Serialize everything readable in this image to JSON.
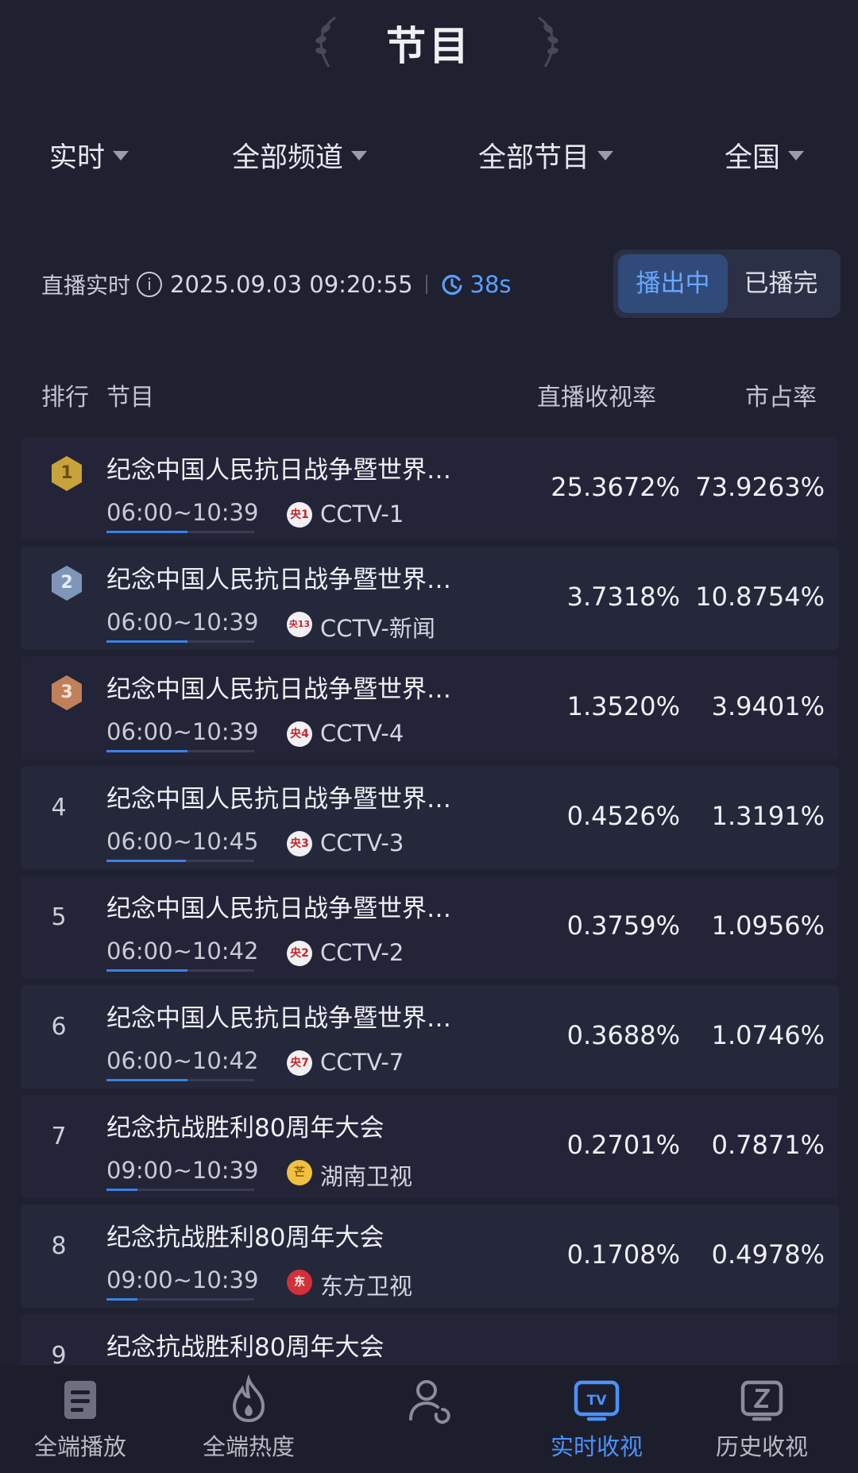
{
  "header": {
    "title": "节目"
  },
  "filters": [
    {
      "label": "实时"
    },
    {
      "label": "全部频道"
    },
    {
      "label": "全部节目"
    },
    {
      "label": "全国"
    }
  ],
  "live": {
    "label": "直播实时",
    "timestamp": "2025.09.03 09:20:55",
    "refresh": "38s"
  },
  "toggle": {
    "on": "播出中",
    "off": "已播完"
  },
  "table": {
    "headers": {
      "rank": "排行",
      "program": "节目",
      "rating": "直播收视率",
      "share": "市占率"
    },
    "rows": [
      {
        "rank": "1",
        "title": "纪念中国人民抗日战争暨世界…",
        "time": "06:00~10:39",
        "channel": "CCTV-1",
        "logo": "央1",
        "rating": "25.3672%",
        "share": "73.9263%",
        "progress": 0.55
      },
      {
        "rank": "2",
        "title": "纪念中国人民抗日战争暨世界…",
        "time": "06:00~10:39",
        "channel": "CCTV-新闻",
        "logo": "央13",
        "rating": "3.7318%",
        "share": "10.8754%",
        "progress": 0.55
      },
      {
        "rank": "3",
        "title": "纪念中国人民抗日战争暨世界…",
        "time": "06:00~10:39",
        "channel": "CCTV-4",
        "logo": "央4",
        "rating": "1.3520%",
        "share": "3.9401%",
        "progress": 0.55
      },
      {
        "rank": "4",
        "title": "纪念中国人民抗日战争暨世界…",
        "time": "06:00~10:45",
        "channel": "CCTV-3",
        "logo": "央3",
        "rating": "0.4526%",
        "share": "1.3191%",
        "progress": 0.54
      },
      {
        "rank": "5",
        "title": "纪念中国人民抗日战争暨世界…",
        "time": "06:00~10:42",
        "channel": "CCTV-2",
        "logo": "央2",
        "rating": "0.3759%",
        "share": "1.0956%",
        "progress": 0.55
      },
      {
        "rank": "6",
        "title": "纪念中国人民抗日战争暨世界…",
        "time": "06:00~10:42",
        "channel": "CCTV-7",
        "logo": "央7",
        "rating": "0.3688%",
        "share": "1.0746%",
        "progress": 0.55
      },
      {
        "rank": "7",
        "title": "纪念抗战胜利80周年大会",
        "time": "09:00~10:39",
        "channel": "湖南卫视",
        "logo": "芒",
        "rating": "0.2701%",
        "share": "0.7871%",
        "progress": 0.21
      },
      {
        "rank": "8",
        "title": "纪念抗战胜利80周年大会",
        "time": "09:00~10:39",
        "channel": "东方卫视",
        "logo": "东",
        "rating": "0.1708%",
        "share": "0.4978%",
        "progress": 0.21
      },
      {
        "rank": "9",
        "title": "纪念抗战胜利80周年大会",
        "time": "",
        "channel": "",
        "logo": "",
        "rating": "",
        "share": "",
        "progress": 0
      }
    ]
  },
  "nav": [
    {
      "label": "全端播放",
      "icon": "document-icon"
    },
    {
      "label": "全端热度",
      "icon": "flame-icon"
    },
    {
      "label": "",
      "icon": "user-icon"
    },
    {
      "label": "实时收视",
      "icon": "tv-icon",
      "active": true
    },
    {
      "label": "历史收视",
      "icon": "history-icon"
    }
  ],
  "colors": {
    "accent": "#4b92ff",
    "gold": "#c9a23c",
    "silver": "#7f96b8",
    "bronze": "#c0805a"
  }
}
